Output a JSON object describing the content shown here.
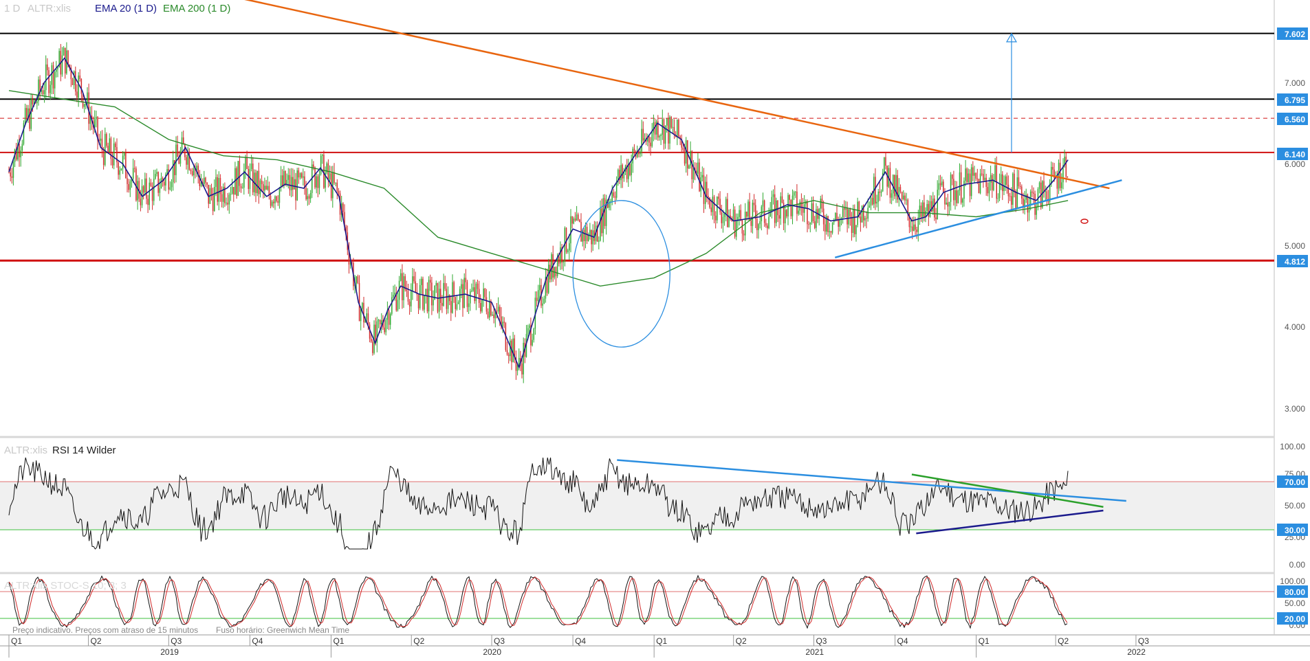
{
  "colors": {
    "orange": "#e8650f",
    "black_line": "#000000",
    "red_line": "#d01010",
    "blue_light": "#2b8ee0",
    "tag_blue": "#2b8ee0",
    "ema20": "#1a1a8c",
    "ema200": "#2a8a2a",
    "up": "#2fa82f",
    "down": "#d12a2a"
  },
  "legend": {
    "main_timeframe": "1 D",
    "main_symbol": "ALTR:xlis",
    "ema20": "EMA 20  (1 D)",
    "ema200": "EMA 200  (1 D)",
    "rsi_symbol": "ALTR:xlis",
    "rsi": "RSI 14 Wilder",
    "stoch": "ALTR:xlis STOC-S 10; 3; 3"
  },
  "footer": {
    "disclaimer": "Preço indicativo. Preços com atraso de 15 minutos",
    "timezone": "Fuso horário: Greenwich Mean Time"
  },
  "price_axis": {
    "ticks": [
      "7.000",
      "6.000",
      "5.000",
      "4.000",
      "3.000"
    ],
    "tags": [
      "7.602",
      "6.795",
      "6.560",
      "6.140",
      "4.812"
    ]
  },
  "rsi_axis": {
    "ticks": [
      "100.00",
      "75.00",
      "50.00",
      "25.00",
      "0.00"
    ],
    "tags": [
      "70.00",
      "30.00"
    ]
  },
  "stoch_axis": {
    "ticks": [
      "100.00",
      "50.00",
      "0.00"
    ],
    "tags": [
      "80.00",
      "20.00"
    ]
  },
  "time_axis": {
    "quarters": [
      "Q1",
      "Q2",
      "Q3",
      "Q4",
      "Q1",
      "Q2",
      "Q3",
      "Q4",
      "Q1",
      "Q2",
      "Q3",
      "Q4",
      "Q1",
      "Q2",
      "Q3"
    ],
    "years": [
      "2019",
      "2020",
      "2021",
      "2022"
    ]
  },
  "chart_data": {
    "type": "candlestick",
    "symbol": "ALTR:xlis",
    "timeframe": "1 D",
    "ylim": [
      2.75,
      8.0
    ],
    "horizontal_levels": [
      7.602,
      6.795,
      6.56,
      6.14,
      4.812
    ],
    "series": [
      {
        "name": "EMA 20",
        "x": [
          "2019-01-01",
          "2019-01-20",
          "2019-02-10",
          "2019-03-05",
          "2019-03-25",
          "2019-04-15",
          "2019-05-10",
          "2019-06-01",
          "2019-06-25",
          "2019-07-20",
          "2019-08-15",
          "2019-09-05",
          "2019-09-25",
          "2019-10-20",
          "2019-11-10",
          "2019-12-01",
          "2019-12-20",
          "2020-01-10",
          "2020-02-01",
          "2020-02-20",
          "2020-03-05",
          "2020-03-20",
          "2020-04-10",
          "2020-05-01",
          "2020-06-01",
          "2020-07-01",
          "2020-08-01",
          "2020-09-01",
          "2020-10-01",
          "2020-10-25",
          "2020-11-15",
          "2020-12-10",
          "2021-01-05",
          "2021-02-01",
          "2021-03-01",
          "2021-04-01",
          "2021-05-01",
          "2021-06-01",
          "2021-06-25",
          "2021-07-20",
          "2021-08-20",
          "2021-09-20",
          "2021-10-20",
          "2021-11-05",
          "2021-11-25",
          "2021-12-20",
          "2022-01-20",
          "2022-02-15",
          "2022-03-10",
          "2022-03-30",
          "2022-04-15"
        ],
        "y": [
          5.9,
          6.5,
          7.0,
          7.3,
          6.9,
          6.2,
          6.0,
          5.6,
          5.8,
          6.2,
          5.6,
          5.7,
          5.9,
          5.6,
          5.75,
          5.7,
          5.95,
          5.6,
          4.3,
          3.8,
          4.2,
          4.5,
          4.4,
          4.35,
          4.4,
          4.3,
          3.5,
          4.6,
          5.2,
          5.1,
          5.7,
          6.1,
          6.5,
          6.3,
          5.6,
          5.3,
          5.35,
          5.5,
          5.45,
          5.3,
          5.35,
          5.9,
          5.3,
          5.35,
          5.65,
          5.75,
          5.8,
          5.65,
          5.55,
          5.8,
          6.05
        ]
      },
      {
        "name": "EMA 200",
        "x": [
          "2019-01-01",
          "2019-03-01",
          "2019-05-01",
          "2019-07-01",
          "2019-09-01",
          "2019-11-01",
          "2020-01-01",
          "2020-03-01",
          "2020-05-01",
          "2020-07-01",
          "2020-09-01",
          "2020-11-01",
          "2021-01-01",
          "2021-03-01",
          "2021-05-01",
          "2021-07-01",
          "2021-09-01",
          "2021-11-01",
          "2022-01-01",
          "2022-03-01",
          "2022-04-15"
        ],
        "y": [
          6.9,
          6.8,
          6.7,
          6.3,
          6.1,
          6.05,
          5.9,
          5.7,
          5.1,
          4.9,
          4.7,
          4.5,
          4.6,
          4.9,
          5.4,
          5.55,
          5.4,
          5.4,
          5.35,
          5.45,
          5.55
        ]
      }
    ],
    "annotations": [
      {
        "type": "trendline",
        "color": "orange",
        "from": [
          "2018-11-01",
          8.8
        ],
        "to": [
          "2022-06-01",
          5.7
        ]
      },
      {
        "type": "trendline",
        "color": "blue",
        "from": [
          "2021-07-25",
          4.85
        ],
        "to": [
          "2022-06-15",
          5.8
        ]
      },
      {
        "type": "arrow",
        "color": "blue",
        "from": [
          "2022-02-10",
          6.14
        ],
        "to": [
          "2022-02-10",
          7.6
        ]
      },
      {
        "type": "ellipse",
        "color": "blue",
        "center": [
          "2020-11-25",
          4.65
        ],
        "rx_days": 55,
        "ry": 0.9
      }
    ],
    "rsi": {
      "name": "RSI 14 Wilder",
      "levels": [
        70,
        30
      ],
      "ylim": [
        0,
        100
      ],
      "last_value": 77,
      "trendlines": [
        {
          "color": "blue",
          "from": [
            "2020-11-20",
            86
          ],
          "to": [
            "2022-06-20",
            52
          ]
        },
        {
          "color": "green",
          "from": [
            "2021-10-20",
            74
          ],
          "to": [
            "2022-05-25",
            47
          ]
        },
        {
          "color": "navy",
          "from": [
            "2021-10-25",
            25
          ],
          "to": [
            "2022-05-25",
            44
          ]
        }
      ]
    },
    "stochastic": {
      "name": "STOC-S 10; 3; 3",
      "levels": [
        80,
        20
      ],
      "ylim": [
        0,
        100
      ]
    }
  }
}
